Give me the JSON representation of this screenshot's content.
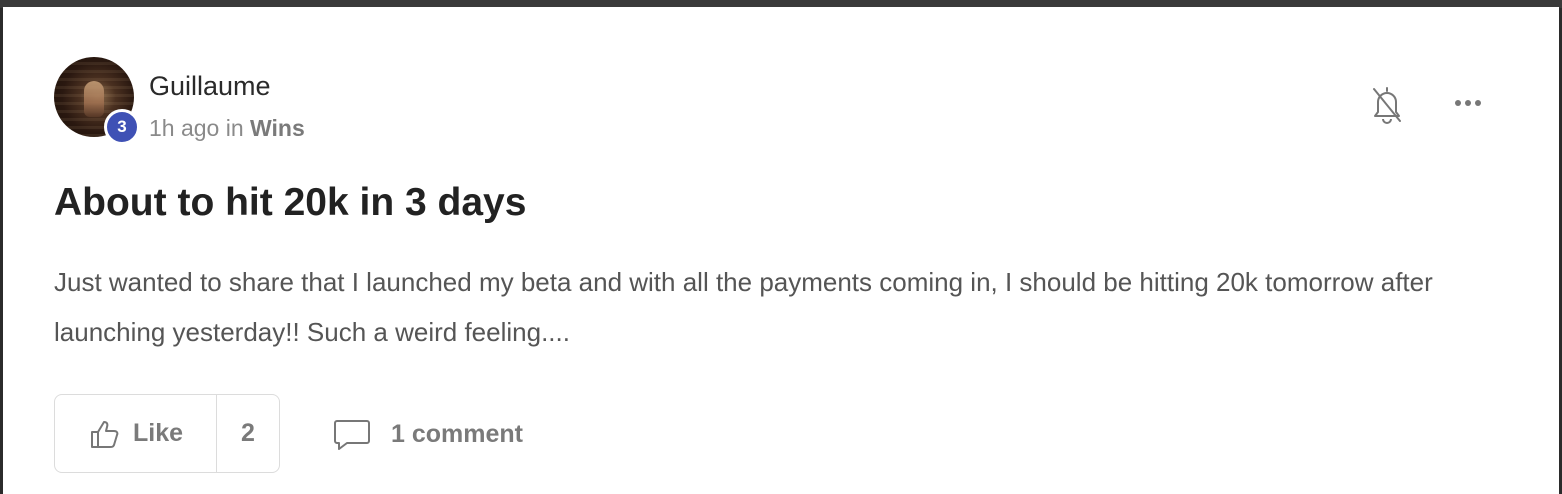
{
  "post": {
    "author": "Guillaume",
    "level": "3",
    "time_ago": "1h ago in",
    "category": "Wins",
    "title": "About to hit 20k in 3 days",
    "body": "Just wanted to share that I launched my beta and with all the payments coming in, I should be hitting 20k tomorrow after launching yesterday!! Such a weird feeling...."
  },
  "actions": {
    "like_label": "Like",
    "like_count": "2",
    "comment_label": "1 comment"
  },
  "icons": {
    "notifications": "bell-off-icon",
    "more": "more-horizontal-icon",
    "like": "thumbs-up-icon",
    "comment": "comment-icon"
  },
  "colors": {
    "level_badge": "#3f51b5",
    "text_primary": "#222222",
    "text_muted": "#7a7a7a"
  }
}
